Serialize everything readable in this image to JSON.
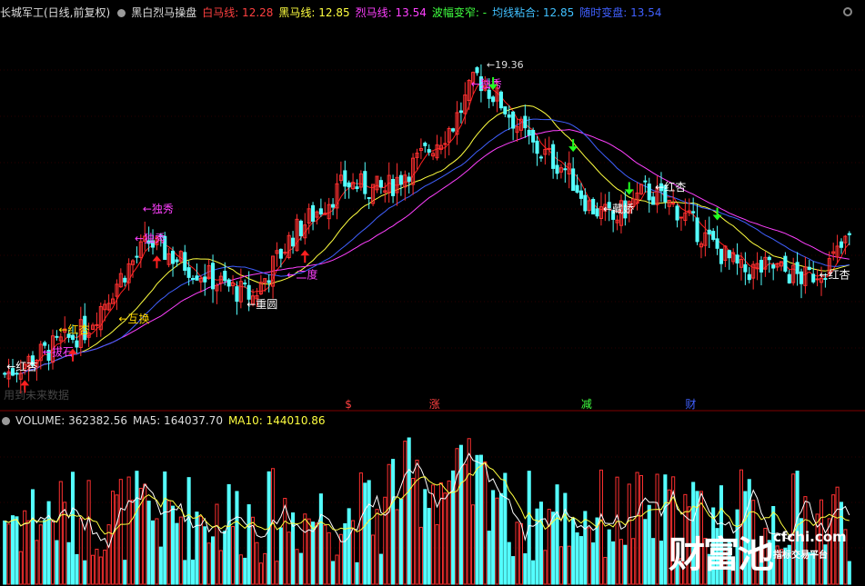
{
  "header": {
    "stock": "长城军工(日线,前复权)",
    "indicator": "黑白烈马操盘",
    "items": [
      {
        "label": "白马线: ",
        "value": "12.28",
        "color": "#ff4040"
      },
      {
        "label": "黑马线: ",
        "value": "12.85",
        "color": "#ffff40"
      },
      {
        "label": "烈马线: ",
        "value": "13.54",
        "color": "#ff40ff"
      },
      {
        "label": "波幅变窄: ",
        "value": "-",
        "color": "#40ff40"
      },
      {
        "label": "均线粘合: ",
        "value": "12.85",
        "color": "#40c0ff"
      },
      {
        "label": "随时变盘: ",
        "value": "13.54",
        "color": "#4060ff"
      }
    ]
  },
  "volume_header": {
    "volume": "VOLUME: 362382.56",
    "ma5": "MA5: 164037.70",
    "ma10": "MA10: 144010.86"
  },
  "no_data_text": "用到未来数据",
  "watermark": {
    "cn": "财富池",
    "domain": "cfchi.com",
    "sub": "指标交易平台"
  },
  "chart_data": {
    "type": "candlestick",
    "max_label": "19.36",
    "price_range": [
      9.5,
      20
    ],
    "candles": [],
    "annotations": [
      {
        "text": "红杏",
        "i": 0,
        "price": 10.5,
        "color": "#ffffff"
      },
      {
        "text": "拔石",
        "i": 9,
        "price": 10.9,
        "color": "#ff40ff"
      },
      {
        "text": "红杏",
        "i": 13,
        "price": 11.5,
        "color": "#ffd700"
      },
      {
        "text": "互换",
        "i": 28,
        "price": 11.8,
        "color": "#ffd700"
      },
      {
        "text": "独秀",
        "i": 34,
        "price": 14.8,
        "color": "#ff40ff"
      },
      {
        "text": "独秀",
        "i": 32,
        "price": 14.0,
        "color": "#ff40ff"
      },
      {
        "text": "重圆",
        "i": 60,
        "price": 12.2,
        "color": "#ffffff"
      },
      {
        "text": "二度",
        "i": 70,
        "price": 13.0,
        "color": "#ff40ff"
      },
      {
        "text": "独秀",
        "i": 116,
        "price": 18.2,
        "color": "#ff40ff"
      },
      {
        "text": "藏娇",
        "i": 149,
        "price": 14.8,
        "color": "#ffffff"
      },
      {
        "text": "红杏",
        "i": 162,
        "price": 15.4,
        "color": "#ffffff"
      },
      {
        "text": "红杏",
        "i": 203,
        "price": 13.0,
        "color": "#ffffff"
      }
    ],
    "bottom_markers": [
      {
        "text": "$",
        "i": 85,
        "color": "#ff4040"
      },
      {
        "text": "涨",
        "i": 106,
        "color": "#ff4040"
      },
      {
        "text": "减",
        "i": 144,
        "color": "#40ff40"
      },
      {
        "text": "财",
        "i": 170,
        "color": "#4060ff"
      }
    ]
  }
}
